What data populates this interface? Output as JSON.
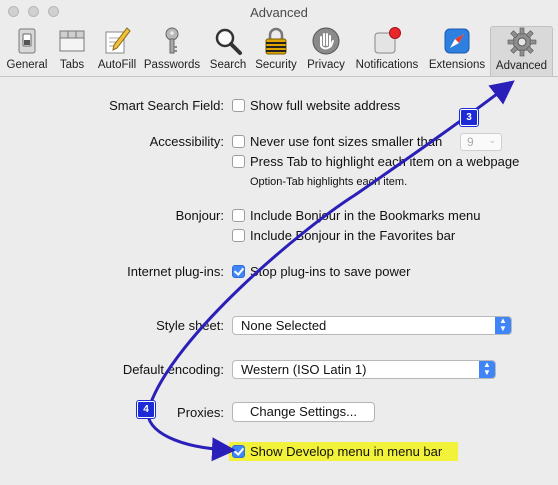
{
  "window": {
    "title": "Advanced"
  },
  "toolbar": {
    "items": [
      {
        "label": "General",
        "icon": "general-switch-icon"
      },
      {
        "label": "Tabs",
        "icon": "tabs-window-icon"
      },
      {
        "label": "AutoFill",
        "icon": "pencil-form-icon"
      },
      {
        "label": "Passwords",
        "icon": "key-icon"
      },
      {
        "label": "Search",
        "icon": "magnifier-icon"
      },
      {
        "label": "Security",
        "icon": "padlock-icon"
      },
      {
        "label": "Privacy",
        "icon": "hand-icon"
      },
      {
        "label": "Notifications",
        "icon": "notification-badge-icon"
      },
      {
        "label": "Extensions",
        "icon": "compass-icon"
      },
      {
        "label": "Advanced",
        "icon": "gear-icon",
        "selected": true
      }
    ]
  },
  "settings": {
    "smart_search": {
      "label": "Smart Search Field:",
      "option": "Show full website address",
      "checked": false
    },
    "accessibility": {
      "label": "Accessibility:",
      "option1": "Never use font sizes smaller than",
      "option1_checked": false,
      "font_size": "9",
      "option2": "Press Tab to highlight each item on a webpage",
      "option2_checked": false,
      "note": "Option-Tab highlights each item."
    },
    "bonjour": {
      "label": "Bonjour:",
      "option1": "Include Bonjour in the Bookmarks menu",
      "option1_checked": false,
      "option2": "Include Bonjour in the Favorites bar",
      "option2_checked": false
    },
    "plugins": {
      "label": "Internet plug-ins:",
      "option": "Stop plug-ins to save power",
      "checked": true
    },
    "style_sheet": {
      "label": "Style sheet:",
      "value": "None Selected"
    },
    "encoding": {
      "label": "Default encoding:",
      "value": "Western (ISO Latin 1)"
    },
    "proxies": {
      "label": "Proxies:",
      "button": "Change Settings..."
    },
    "develop": {
      "option": "Show Develop menu in menu bar",
      "checked": true
    }
  },
  "annotations": {
    "step3": "3",
    "step4": "4",
    "arrow_color": "#2a1fb8",
    "highlight_color": "#f2f23a"
  }
}
